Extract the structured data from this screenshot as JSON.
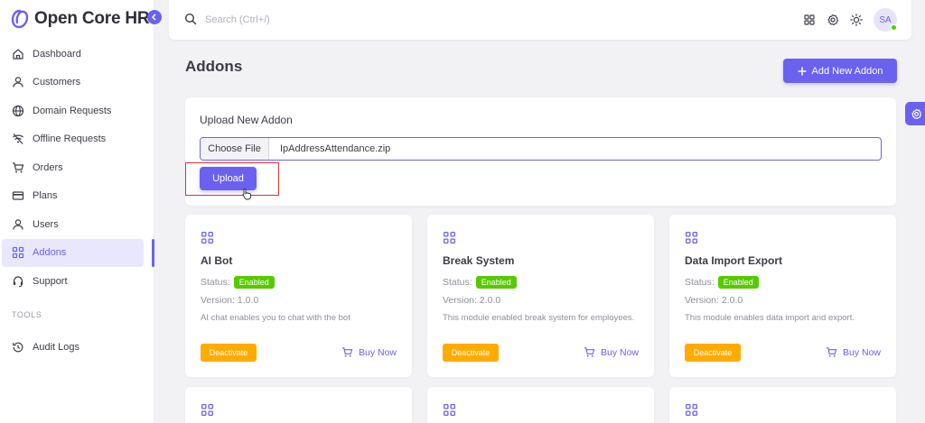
{
  "brand": {
    "name": "Open Core HR"
  },
  "sidebar": {
    "items": [
      {
        "label": "Dashboard",
        "icon": "home-icon"
      },
      {
        "label": "Customers",
        "icon": "user-icon"
      },
      {
        "label": "Domain Requests",
        "icon": "globe-icon"
      },
      {
        "label": "Offline Requests",
        "icon": "wifi-off-icon"
      },
      {
        "label": "Orders",
        "icon": "cart-icon"
      },
      {
        "label": "Plans",
        "icon": "credit-card-icon"
      },
      {
        "label": "Users",
        "icon": "user-icon"
      },
      {
        "label": "Addons",
        "icon": "apps-icon",
        "active": true
      },
      {
        "label": "Support",
        "icon": "headset-icon"
      }
    ],
    "section_tools": "TOOLS",
    "tools_items": [
      {
        "label": "Audit Logs",
        "icon": "history-icon"
      }
    ]
  },
  "topbar": {
    "search_placeholder": "Search (Ctrl+/)",
    "avatar_initials": "SA"
  },
  "page": {
    "title": "Addons",
    "add_button_label": "Add New Addon"
  },
  "upload": {
    "title": "Upload New Addon",
    "choose_file_label": "Choose File",
    "file_name": "IpAddressAttendance.zip",
    "upload_button_label": "Upload"
  },
  "addons": [
    {
      "name": "AI Bot",
      "status_label": "Status:",
      "status": "Enabled",
      "version_label": "Version:",
      "version": "1.0.0",
      "description": "AI chat enables you to chat with the bot",
      "action_label": "Deactivate",
      "buy_label": "Buy Now"
    },
    {
      "name": "Break System",
      "status_label": "Status:",
      "status": "Enabled",
      "version_label": "Version:",
      "version": "2.0.0",
      "description": "This module enabled break system for employees.",
      "action_label": "Deactivate",
      "buy_label": "Buy Now"
    },
    {
      "name": "Data Import Export",
      "status_label": "Status:",
      "status": "Enabled",
      "version_label": "Version:",
      "version": "2.0.0",
      "description": "This module enables data import and export.",
      "action_label": "Deactivate",
      "buy_label": "Buy Now"
    }
  ],
  "colors": {
    "primary": "#6a61f0",
    "success": "#56ca00",
    "warning": "#ffab00",
    "highlight": "#e03131"
  }
}
